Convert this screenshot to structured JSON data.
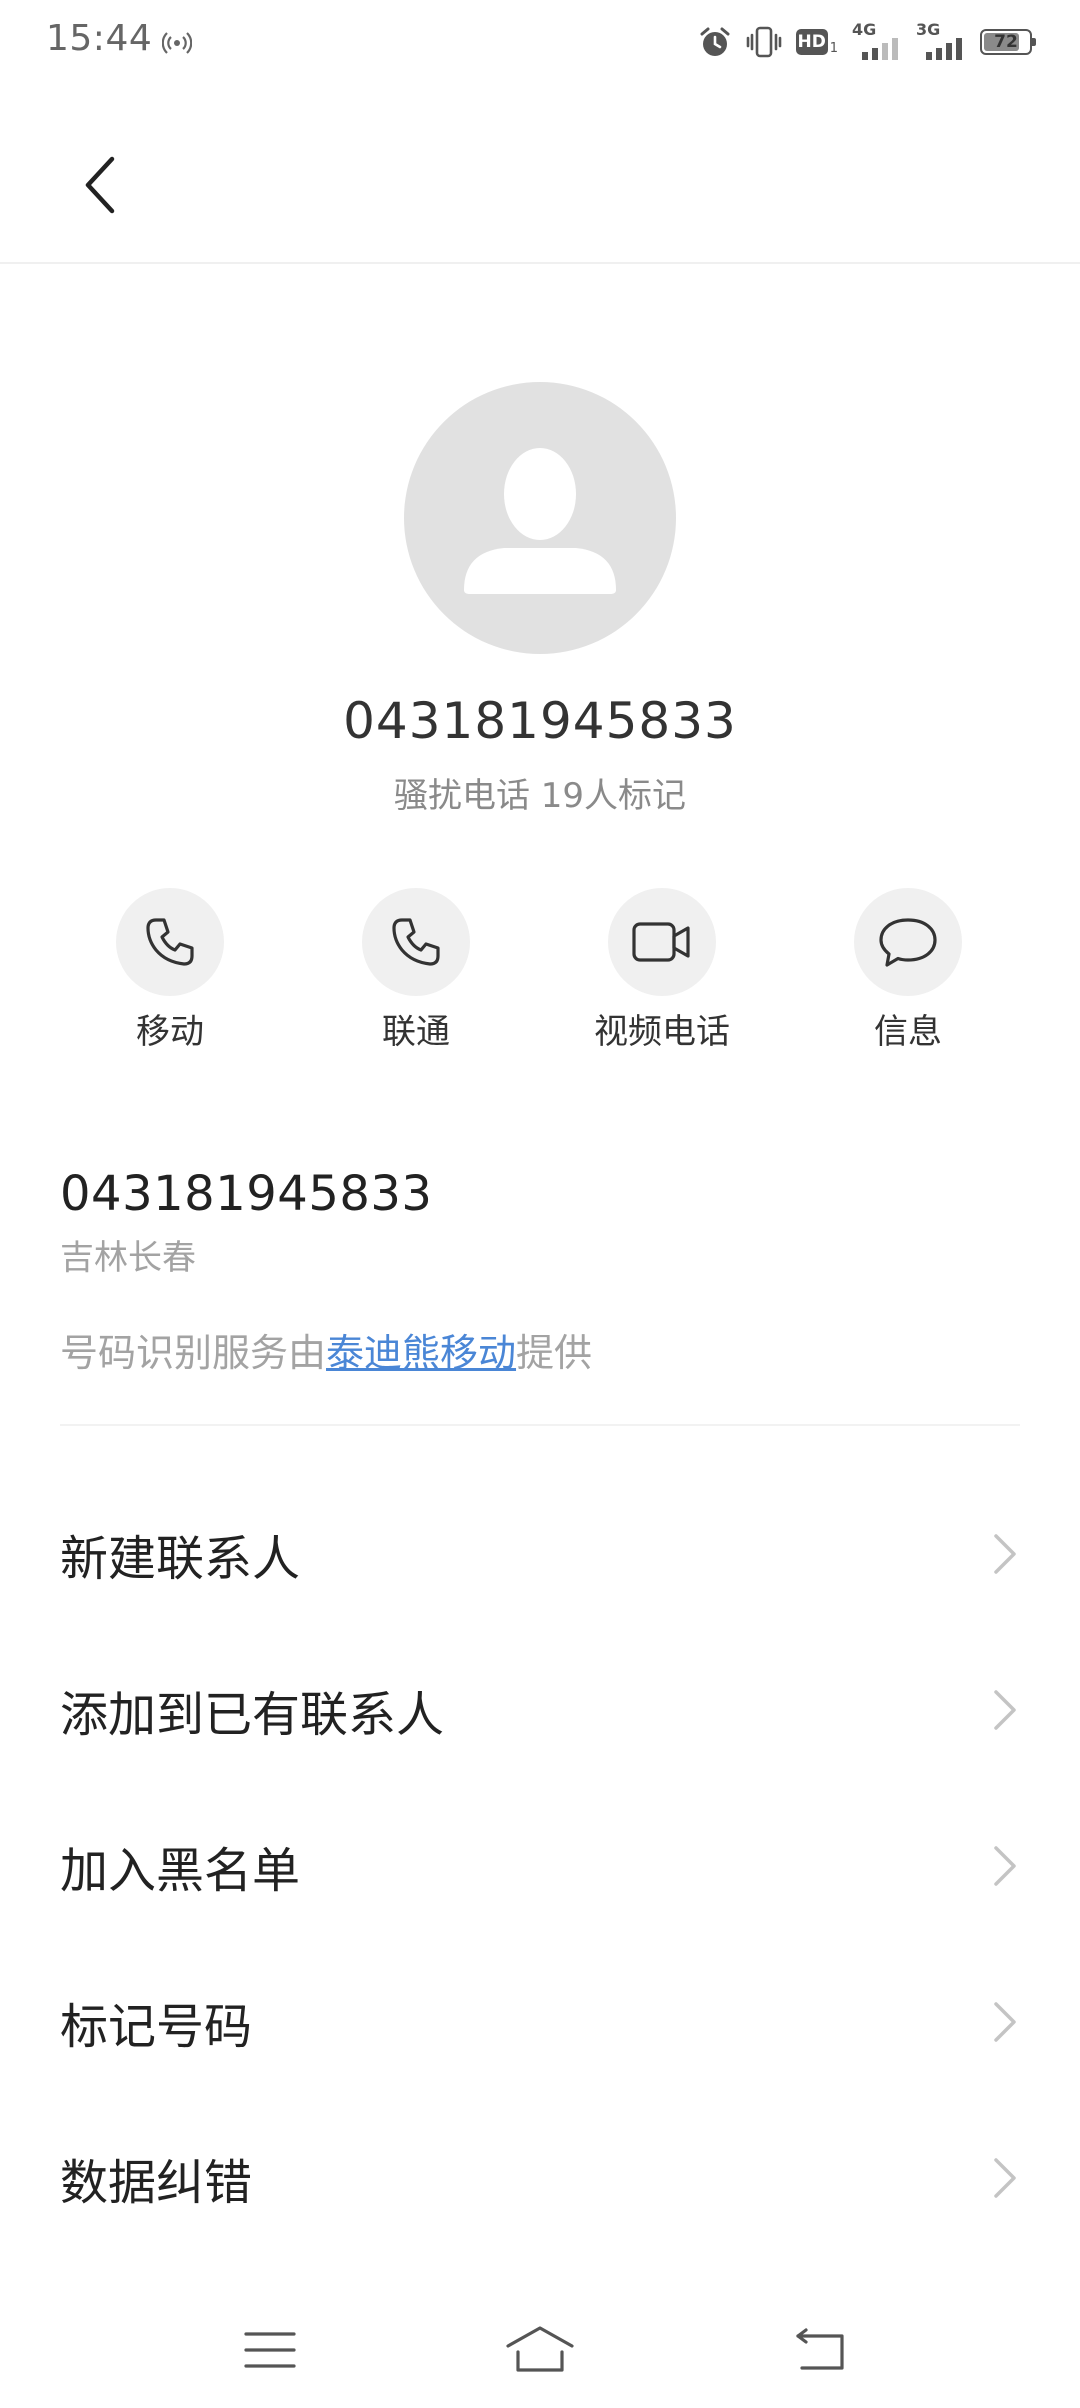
{
  "status_bar": {
    "time": "15:44",
    "hd_label": "HD",
    "hd_sub": "1",
    "signal_1_label": "4G",
    "signal_2_label": "3G",
    "battery_level": "72",
    "icons": [
      "hotspot-icon",
      "alarm-icon",
      "vibrate-icon",
      "hd-volte-icon",
      "signal-4g-icon",
      "signal-3g-icon",
      "battery-icon"
    ]
  },
  "header": {
    "back_icon": "chevron-left-icon"
  },
  "caller": {
    "number": "043181945833",
    "tag": "骚扰电话 19人标记",
    "avatar_icon": "person-icon"
  },
  "actions": [
    {
      "label": "移动",
      "icon": "phone-icon"
    },
    {
      "label": "联通",
      "icon": "phone-icon"
    },
    {
      "label": "视频电话",
      "icon": "video-icon"
    },
    {
      "label": "信息",
      "icon": "message-icon"
    }
  ],
  "number_info": {
    "number": "043181945833",
    "location": "吉林长春",
    "provider_prefix": "号码识别服务由",
    "provider_link": "泰迪熊移动",
    "provider_suffix": "提供"
  },
  "menu": [
    {
      "label": "新建联系人"
    },
    {
      "label": "添加到已有联系人"
    },
    {
      "label": "加入黑名单"
    },
    {
      "label": "标记号码"
    },
    {
      "label": "数据纠错"
    }
  ],
  "nav_bar": {
    "icons": [
      "menu-icon",
      "home-icon",
      "back-icon"
    ]
  },
  "colors": {
    "accent_link": "#4a86d6",
    "avatar_bg": "#e1e1e1",
    "action_bg": "#f0f0f0",
    "secondary_text": "#a3a3a3"
  }
}
